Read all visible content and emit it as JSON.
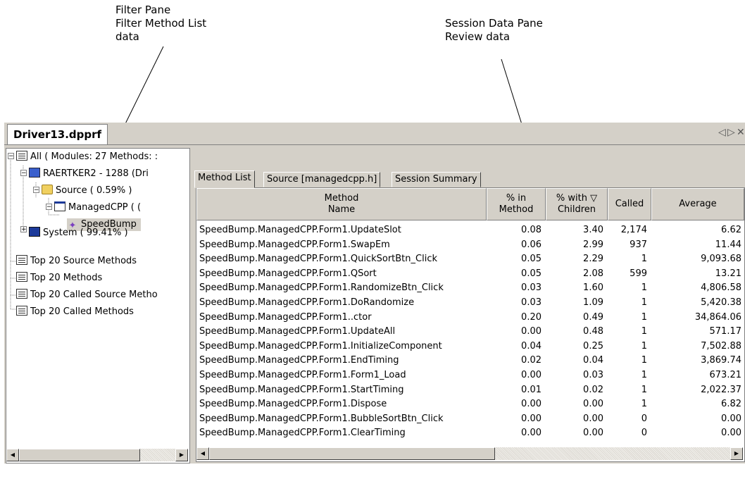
{
  "callouts": {
    "filter_pane": "Filter Pane\nFilter Method List\ndata",
    "session_data_pane": "Session Data Pane\nReview data"
  },
  "window": {
    "doc_tab": "Driver13.dpprf",
    "controls": [
      "◁",
      "▷",
      "✕"
    ]
  },
  "tree": {
    "items": [
      {
        "label": "All ( Modules: 27 Methods: :",
        "icon": "list-icon"
      },
      {
        "label": "RAERTKER2 - 1288 (Dri",
        "icon": "computer-icon"
      },
      {
        "label": "Source ( 0.59% )",
        "icon": "folder-icon"
      },
      {
        "label": "ManagedCPP ( (",
        "icon": "window-icon"
      },
      {
        "label": "SpeedBump",
        "icon": "class-icon"
      },
      {
        "label": "System ( 99.41% )",
        "icon": "system-icon"
      },
      {
        "label": "Top 20 Source Methods",
        "icon": "list-icon"
      },
      {
        "label": "Top 20 Methods",
        "icon": "list-icon"
      },
      {
        "label": "Top 20 Called Source Metho",
        "icon": "list-icon"
      },
      {
        "label": "Top 20 Called Methods",
        "icon": "list-icon"
      }
    ]
  },
  "tabs": [
    "Method List",
    "Source [managedcpp.h]",
    "Session Summary"
  ],
  "columns": [
    "Method\nName",
    "% in\nMethod",
    "% with ▽\nChildren",
    "Called",
    "Average"
  ],
  "rows": [
    [
      "SpeedBump.ManagedCPP.Form1.UpdateSlot",
      "0.08",
      "3.40",
      "2,174",
      "6.62"
    ],
    [
      "SpeedBump.ManagedCPP.Form1.SwapEm",
      "0.06",
      "2.99",
      "937",
      "11.44"
    ],
    [
      "SpeedBump.ManagedCPP.Form1.QuickSortBtn_Click",
      "0.05",
      "2.29",
      "1",
      "9,093.68"
    ],
    [
      "SpeedBump.ManagedCPP.Form1.QSort",
      "0.05",
      "2.08",
      "599",
      "13.21"
    ],
    [
      "SpeedBump.ManagedCPP.Form1.RandomizeBtn_Click",
      "0.03",
      "1.60",
      "1",
      "4,806.58"
    ],
    [
      "SpeedBump.ManagedCPP.Form1.DoRandomize",
      "0.03",
      "1.09",
      "1",
      "5,420.38"
    ],
    [
      "SpeedBump.ManagedCPP.Form1..ctor",
      "0.20",
      "0.49",
      "1",
      "34,864.06"
    ],
    [
      "SpeedBump.ManagedCPP.Form1.UpdateAll",
      "0.00",
      "0.48",
      "1",
      "571.17"
    ],
    [
      "SpeedBump.ManagedCPP.Form1.InitializeComponent",
      "0.04",
      "0.25",
      "1",
      "7,502.88"
    ],
    [
      "SpeedBump.ManagedCPP.Form1.EndTiming",
      "0.02",
      "0.04",
      "1",
      "3,869.74"
    ],
    [
      "SpeedBump.ManagedCPP.Form1.Form1_Load",
      "0.00",
      "0.03",
      "1",
      "673.21"
    ],
    [
      "SpeedBump.ManagedCPP.Form1.StartTiming",
      "0.01",
      "0.02",
      "1",
      "2,022.37"
    ],
    [
      "SpeedBump.ManagedCPP.Form1.Dispose",
      "0.00",
      "0.00",
      "1",
      "6.82"
    ],
    [
      "SpeedBump.ManagedCPP.Form1.BubbleSortBtn_Click",
      "0.00",
      "0.00",
      "0",
      "0.00"
    ],
    [
      "SpeedBump.ManagedCPP.Form1.ClearTiming",
      "0.00",
      "0.00",
      "0",
      "0.00"
    ]
  ]
}
